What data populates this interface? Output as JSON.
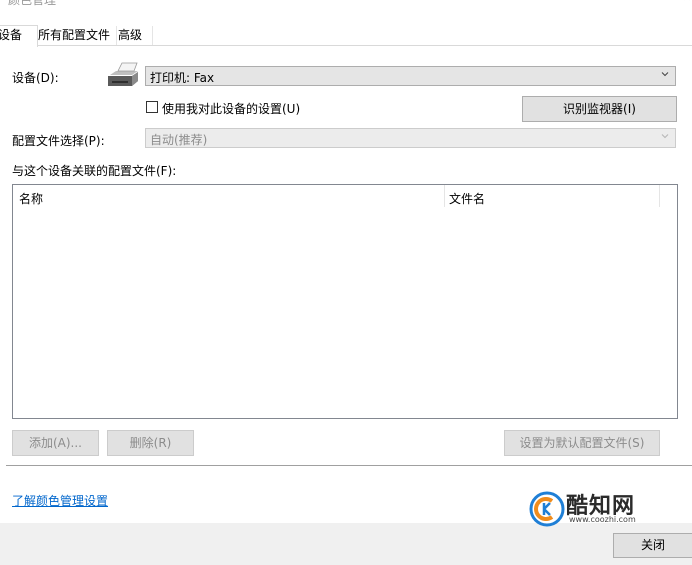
{
  "window": {
    "title": "颜色管理",
    "close_glyph": "✕"
  },
  "tabs": [
    {
      "label": "设备",
      "active": true
    },
    {
      "label": "所有配置文件",
      "active": false
    },
    {
      "label": "高级",
      "active": false
    }
  ],
  "device": {
    "label": "设备(D):",
    "selected": "打印机: Fax",
    "icon": "printer-icon"
  },
  "use_settings_checkbox": {
    "label": "使用我对此设备的设置(U)",
    "checked": false
  },
  "identify_monitors_button": "识别监视器(I)",
  "profile_selection": {
    "label": "配置文件选择(P):",
    "selected": "自动(推荐)"
  },
  "associated_profiles": {
    "label": "与这个设备关联的配置文件(F):",
    "columns": [
      "名称",
      "文件名"
    ],
    "rows": []
  },
  "buttons": {
    "add": "添加(A)...",
    "remove": "删除(R)",
    "set_default": "设置为默认配置文件(S)",
    "close": "关闭"
  },
  "learn_link": "了解颜色管理设置",
  "watermark": {
    "name": "酷知网",
    "url": "www.coozhi.com"
  },
  "colors": {
    "accent_link": "#0066cc",
    "disabled_text": "#8c8c8c",
    "button_bg": "#e1e1e1"
  }
}
